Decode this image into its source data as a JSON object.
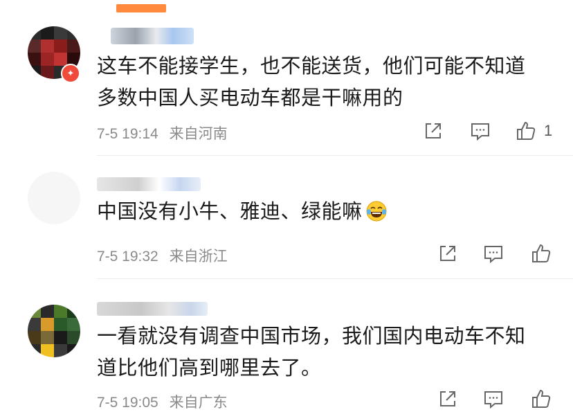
{
  "comments": [
    {
      "text_line1": "这车不能接学生，也不能送货，他们可能不知道",
      "text_line2": "多数中国人买电动车都是干嘛用的",
      "time": "7-5 19:14",
      "location": "来自河南",
      "like_count": "1"
    },
    {
      "text_line1": "中国没有小牛、雅迪、绿能嘛",
      "emoji": "laughing-tears-emoji",
      "time": "7-5 19:32",
      "location": "来自浙江",
      "like_count": ""
    },
    {
      "text_line1": "一看就没有调查中国市场，我们国内电动车不知",
      "text_line2": "道比他们高到哪里去了。",
      "time": "7-5 19:05",
      "location": "来自广东",
      "like_count": ""
    }
  ],
  "icons": {
    "share": "share-icon",
    "comment": "comment-icon",
    "like": "thumbs-up-icon",
    "verified": "verified-badge-icon"
  },
  "colors": {
    "text": "#1a1a1a",
    "meta": "#8a8a8a",
    "icon": "#666666",
    "badge": "#f04a3a",
    "accent": "#ff8a3d"
  }
}
